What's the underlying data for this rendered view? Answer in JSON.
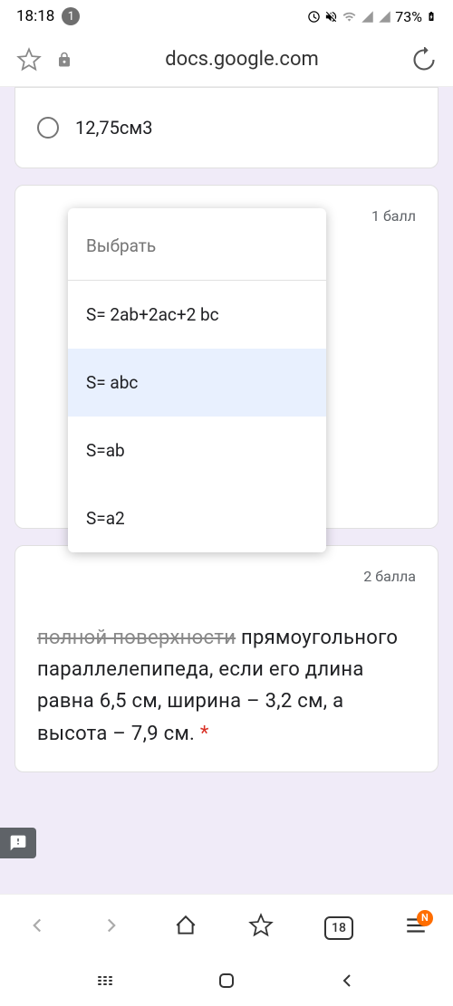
{
  "status": {
    "time": "18:18",
    "notif_count": "1",
    "battery": "73%"
  },
  "browser": {
    "url": "docs.google.com"
  },
  "card1": {
    "option1": "12,75см3"
  },
  "card2": {
    "points": "1 балл"
  },
  "dropdown": {
    "placeholder": "Выбрать",
    "option1": "S= 2ab+2ac+2 bc",
    "option2": "S= abc",
    "option3": "S=ab",
    "option4": "S=a2"
  },
  "card3": {
    "points": "2 балла",
    "question_partial": "полной поверхности",
    "question": "прямоугольного параллелепипеда, если его длина равна 6,5 см, ширина – 3,2 см, а высота – 7,9 см.",
    "required": " *"
  },
  "bottom_nav": {
    "tab_count": "18",
    "badge": "N"
  }
}
